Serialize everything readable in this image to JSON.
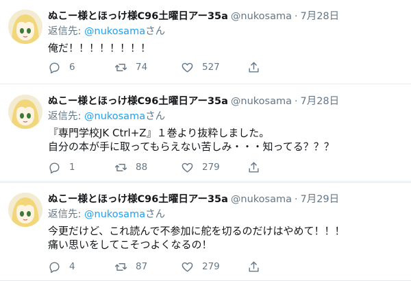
{
  "colors": {
    "accent": "#1da1f2",
    "muted": "#657786",
    "text": "#14171a",
    "divider": "#e6ecf0"
  },
  "tweets": [
    {
      "name": "ぬこー様とほっけ様C96土曜日アー35a",
      "handle": "@nukosama",
      "separator": "·",
      "date": "7月28日",
      "reply_prefix": "返信先: ",
      "reply_to": "@nukosama",
      "reply_suffix": "さん",
      "text_lines": [
        "俺だ！！！！！！！！"
      ],
      "replies": "6",
      "retweets": "74",
      "likes": "527"
    },
    {
      "name": "ぬこー様とほっけ様C96土曜日アー35a",
      "handle": "@nukosama",
      "separator": "·",
      "date": "7月28日",
      "reply_prefix": "返信先: ",
      "reply_to": "@nukosama",
      "reply_suffix": "さん",
      "text_lines": [
        "『専門学校JK Ctrl+Z』１巻より抜粋しました。",
        "自分の本が手に取ってもらえない苦しみ・・・知ってる？？？"
      ],
      "replies": "1",
      "retweets": "88",
      "likes": "279"
    },
    {
      "name": "ぬこー様とほっけ様C96土曜日アー35a",
      "handle": "@nukosama",
      "separator": "·",
      "date": "7月29日",
      "reply_prefix": "返信先: ",
      "reply_to": "@nukosama",
      "reply_suffix": "さん",
      "text_lines": [
        "今更だけど、これ読んで不参加に舵を切るのだけはやめて！！！",
        "痛い思いをしてこそつよくなるの！"
      ],
      "replies": "4",
      "retweets": "87",
      "likes": "279"
    }
  ]
}
